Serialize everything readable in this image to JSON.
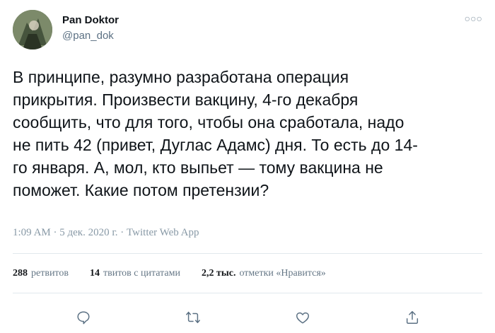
{
  "author": {
    "name": "Pan Doktor",
    "handle": "@pan_dok"
  },
  "tweet": {
    "text": "В принципе, разумно разработана операция\nприкрытия. Произвести вакцину, 4-го декабря\nсообщить, что для того, чтобы она сработала, надо\nне пить 42 (привет, Дуглас Адамс) дня. То есть до 14-\nго января. А, мол, кто выпьет — тому вакцина не\nпоможет. Какие потом претензии?",
    "meta": "1:09 AM · 5 дек. 2020 г. · Twitter Web App"
  },
  "stats": {
    "retweets_count": "288",
    "retweets_label": "ретвитов",
    "quotes_count": "14",
    "quotes_label": "твитов с цитатами",
    "likes_count": "2,2 тыс.",
    "likes_label": "отметки «Нравится»"
  },
  "icons": {
    "more": "more-icon",
    "reply": "reply-icon",
    "retweet": "retweet-icon",
    "like": "like-icon",
    "share": "share-icon"
  },
  "colors": {
    "text": "#0f1419",
    "secondary": "#5b7083",
    "muted": "#8899a6",
    "divider": "#e1e8ed"
  }
}
